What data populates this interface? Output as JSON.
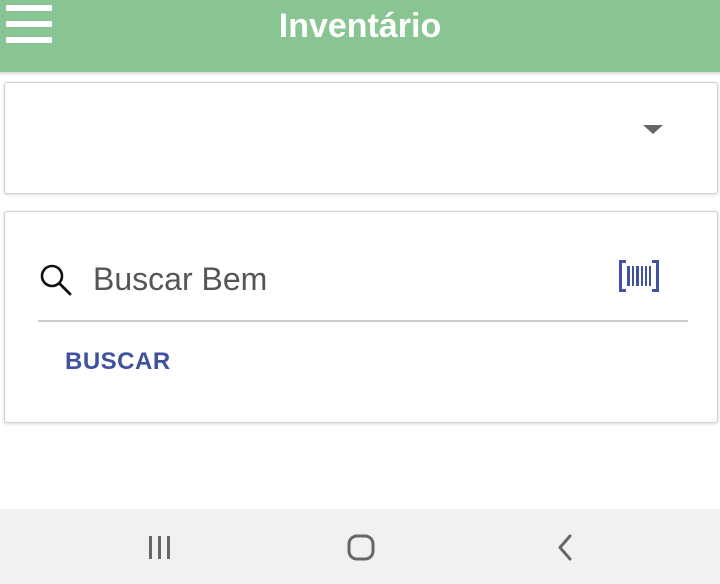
{
  "header": {
    "title": "Inventário",
    "menu_icon": "hamburger-menu-icon",
    "background_color": "#89c593"
  },
  "select_card": {
    "selected_value": "",
    "dropdown_icon": "caret-down-icon"
  },
  "search_card": {
    "input": {
      "value": "",
      "placeholder": "Buscar Bem"
    },
    "search_icon": "magnifier-icon",
    "barcode_icon": "barcode-scanner-icon",
    "button_label": "BUSCAR",
    "accent_color": "#3f51a0"
  },
  "system_nav": {
    "recents_icon": "recent-apps-icon",
    "home_icon": "home-icon",
    "back_icon": "back-icon"
  }
}
